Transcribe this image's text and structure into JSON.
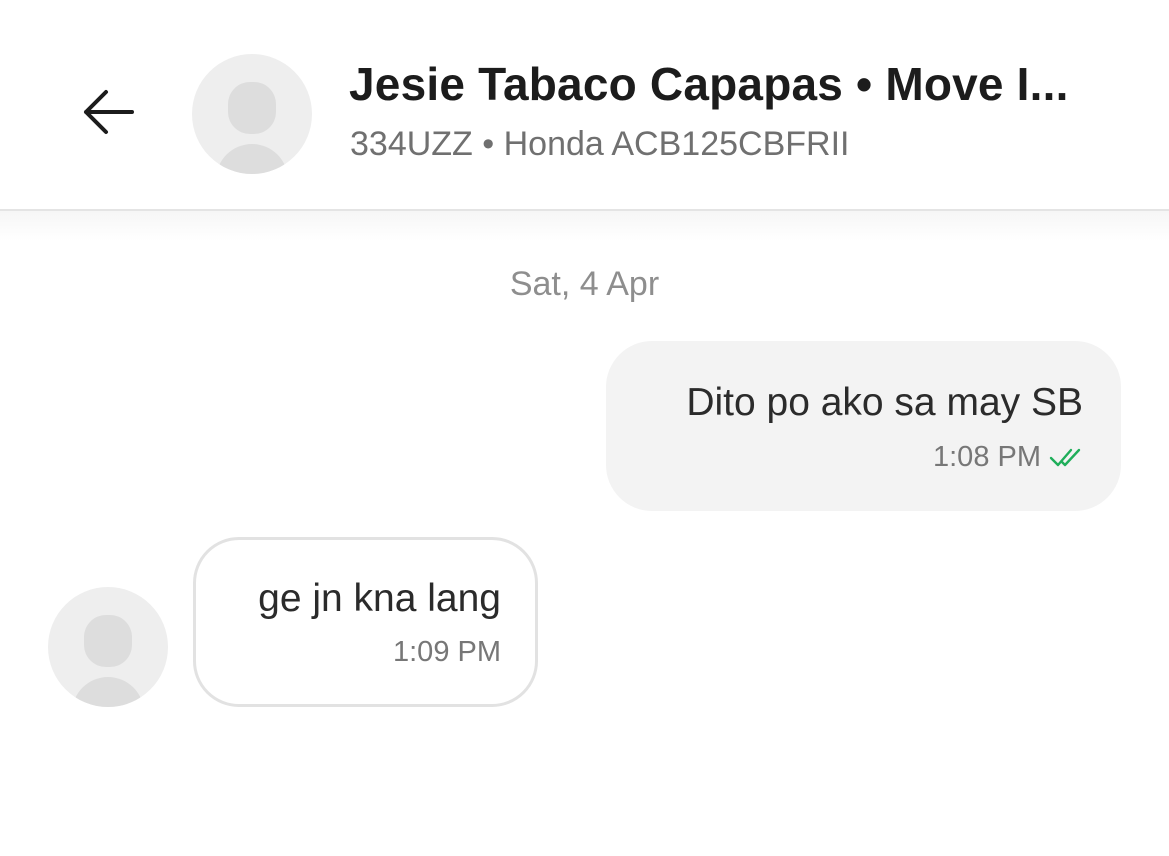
{
  "header": {
    "title": "Jesie Tabaco Capapas • Move I...",
    "subtitle": "334UZZ • Honda ACB125CBFRII",
    "back_icon": "arrow-left-icon",
    "avatar_icon": "person-placeholder-icon"
  },
  "conversation": {
    "date_separator": "Sat, 4 Apr",
    "messages": [
      {
        "direction": "outgoing",
        "text": "Dito po ako sa may SB",
        "time": "1:08 PM",
        "status_icon": "double-check-icon",
        "status_color": "#1fae5a"
      },
      {
        "direction": "incoming",
        "text": "ge jn kna lang",
        "time": "1:09 PM",
        "avatar_icon": "person-placeholder-icon"
      }
    ]
  },
  "colors": {
    "outgoing_bubble": "#f3f3f3",
    "incoming_border": "#e2e2e2",
    "read_tick": "#1fae5a"
  }
}
